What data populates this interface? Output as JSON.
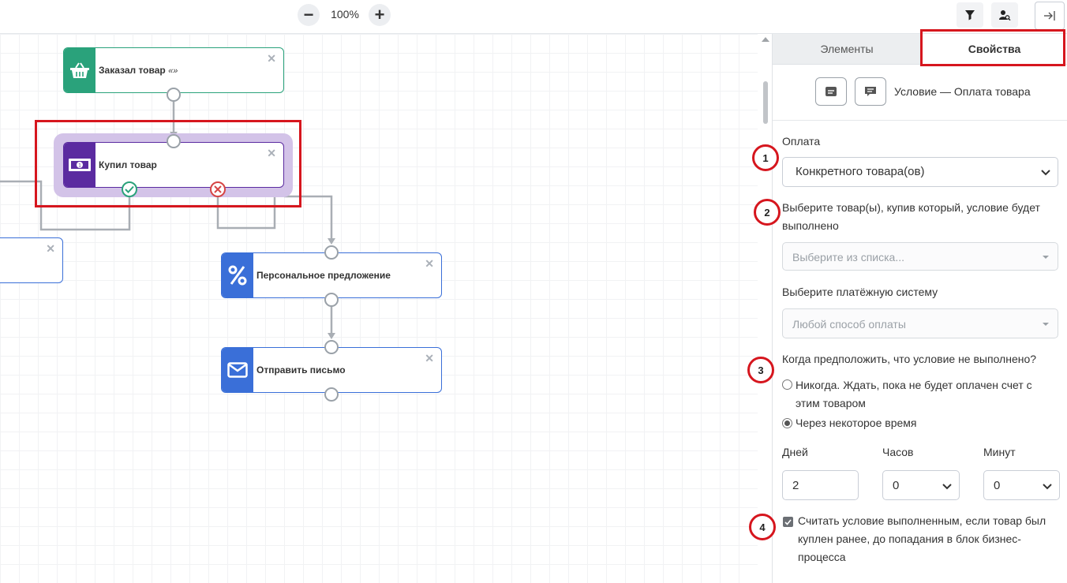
{
  "toolbar": {
    "zoom_out": "−",
    "zoom_level": "100%",
    "zoom_in": "+",
    "icons": [
      "filter-icon",
      "user-search-icon",
      "collapse-panel-icon"
    ]
  },
  "canvas": {
    "nodes": [
      {
        "id": "ordered",
        "label": "Заказал товар",
        "label_suffix": "«»",
        "icon": "basket-icon",
        "color": "#2aa27b",
        "close": "✕"
      },
      {
        "id": "bought",
        "label": "Купил товар",
        "icon": "money-icon",
        "color": "#5b2ba0",
        "close": "✕"
      },
      {
        "id": "offer",
        "label": "Персональное предложение",
        "icon": "percent-icon",
        "color": "#3a6fd8",
        "close": "✕"
      },
      {
        "id": "email",
        "label": "Отправить письмо",
        "icon": "envelope-icon",
        "color": "#3a6fd8",
        "close": "✕"
      },
      {
        "id": "partial",
        "label": "",
        "close": "✕"
      }
    ]
  },
  "panel": {
    "tabs": [
      {
        "label": "Элементы",
        "active": false
      },
      {
        "label": "Свойства",
        "active": true
      }
    ],
    "header_title": "Условие — Оплата товара",
    "payment_label": "Оплата",
    "payment_value": "Конкретного товара(ов)",
    "products_label": "Выберите товар(ы), купив который, условие будет выполнено",
    "products_placeholder": "Выберите из списка...",
    "paysys_label": "Выберите платёжную систему",
    "paysys_placeholder": "Любой способ оплаты",
    "when_label": "Когда предположить, что условие не выполнено?",
    "radio_never": "Никогда. Ждать, пока не будет оплачен счет с этим товаром",
    "radio_time": "Через некоторое время",
    "days_label": "Дней",
    "days_value": "2",
    "hours_label": "Часов",
    "hours_value": "0",
    "minutes_label": "Минут",
    "minutes_value": "0",
    "checkbox_label": "Считать условие выполненным, если товар был куплен ранее, до попадания в блок бизнес-процесса",
    "checkbox_checked": true
  },
  "annotations": [
    "1",
    "2",
    "3",
    "4"
  ],
  "colors": {
    "annotation_red": "#d6161e",
    "selection_purple": "#d3c3e8"
  }
}
